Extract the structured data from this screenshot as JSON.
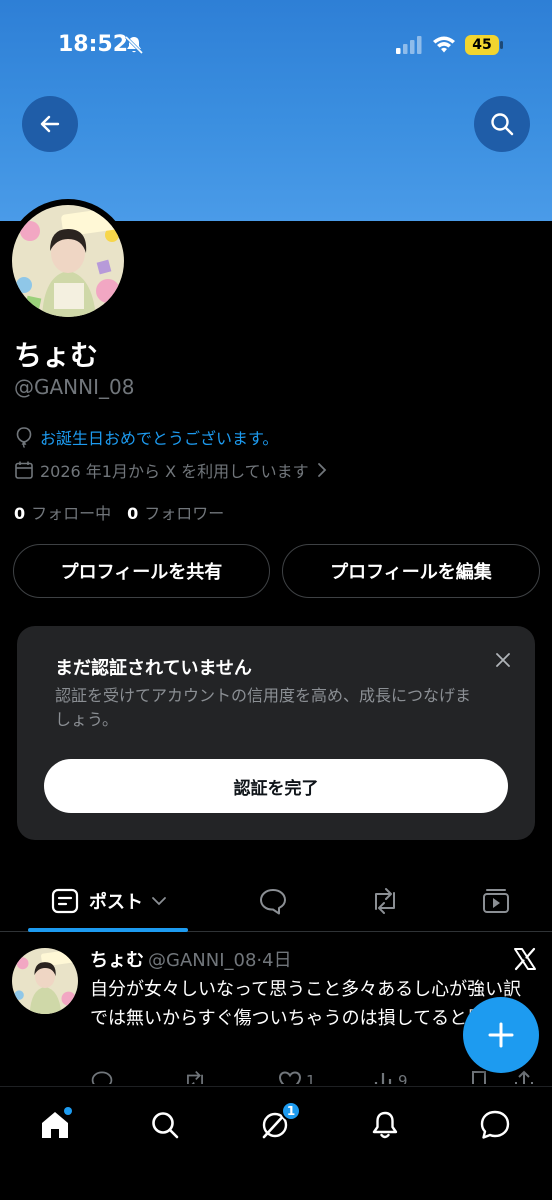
{
  "status_bar": {
    "time": "18:52",
    "battery": "45"
  },
  "profile": {
    "display_name": "ちょむ",
    "handle": "@GANNI_08",
    "birthday": "お誕生日おめでとうございます。",
    "joined": "2026 年1月から X を利用しています",
    "following_count": "0",
    "following_label": "フォロー中",
    "followers_count": "0",
    "followers_label": "フォロワー"
  },
  "buttons": {
    "share": "プロフィールを共有",
    "edit": "プロフィールを編集"
  },
  "verify_card": {
    "title": "まだ認証されていません",
    "description": "認証を受けてアカウントの信用度を高め、成長につなげましょう。",
    "button": "認証を完了"
  },
  "tabs": {
    "posts": "ポスト"
  },
  "post": {
    "name": "ちょむ",
    "meta": "@GANNI_08·4日",
    "text": "自分が女々しいなって思うこと多々あるし心が強い訳では無いからすぐ傷ついちゃうのは損してると思う",
    "likes": "1",
    "views": "9"
  },
  "nav": {
    "grok_badge": "1"
  },
  "colors": {
    "accent": "#1d9bf0",
    "banner": "#3b8fe0",
    "battery": "#f2d52f"
  }
}
